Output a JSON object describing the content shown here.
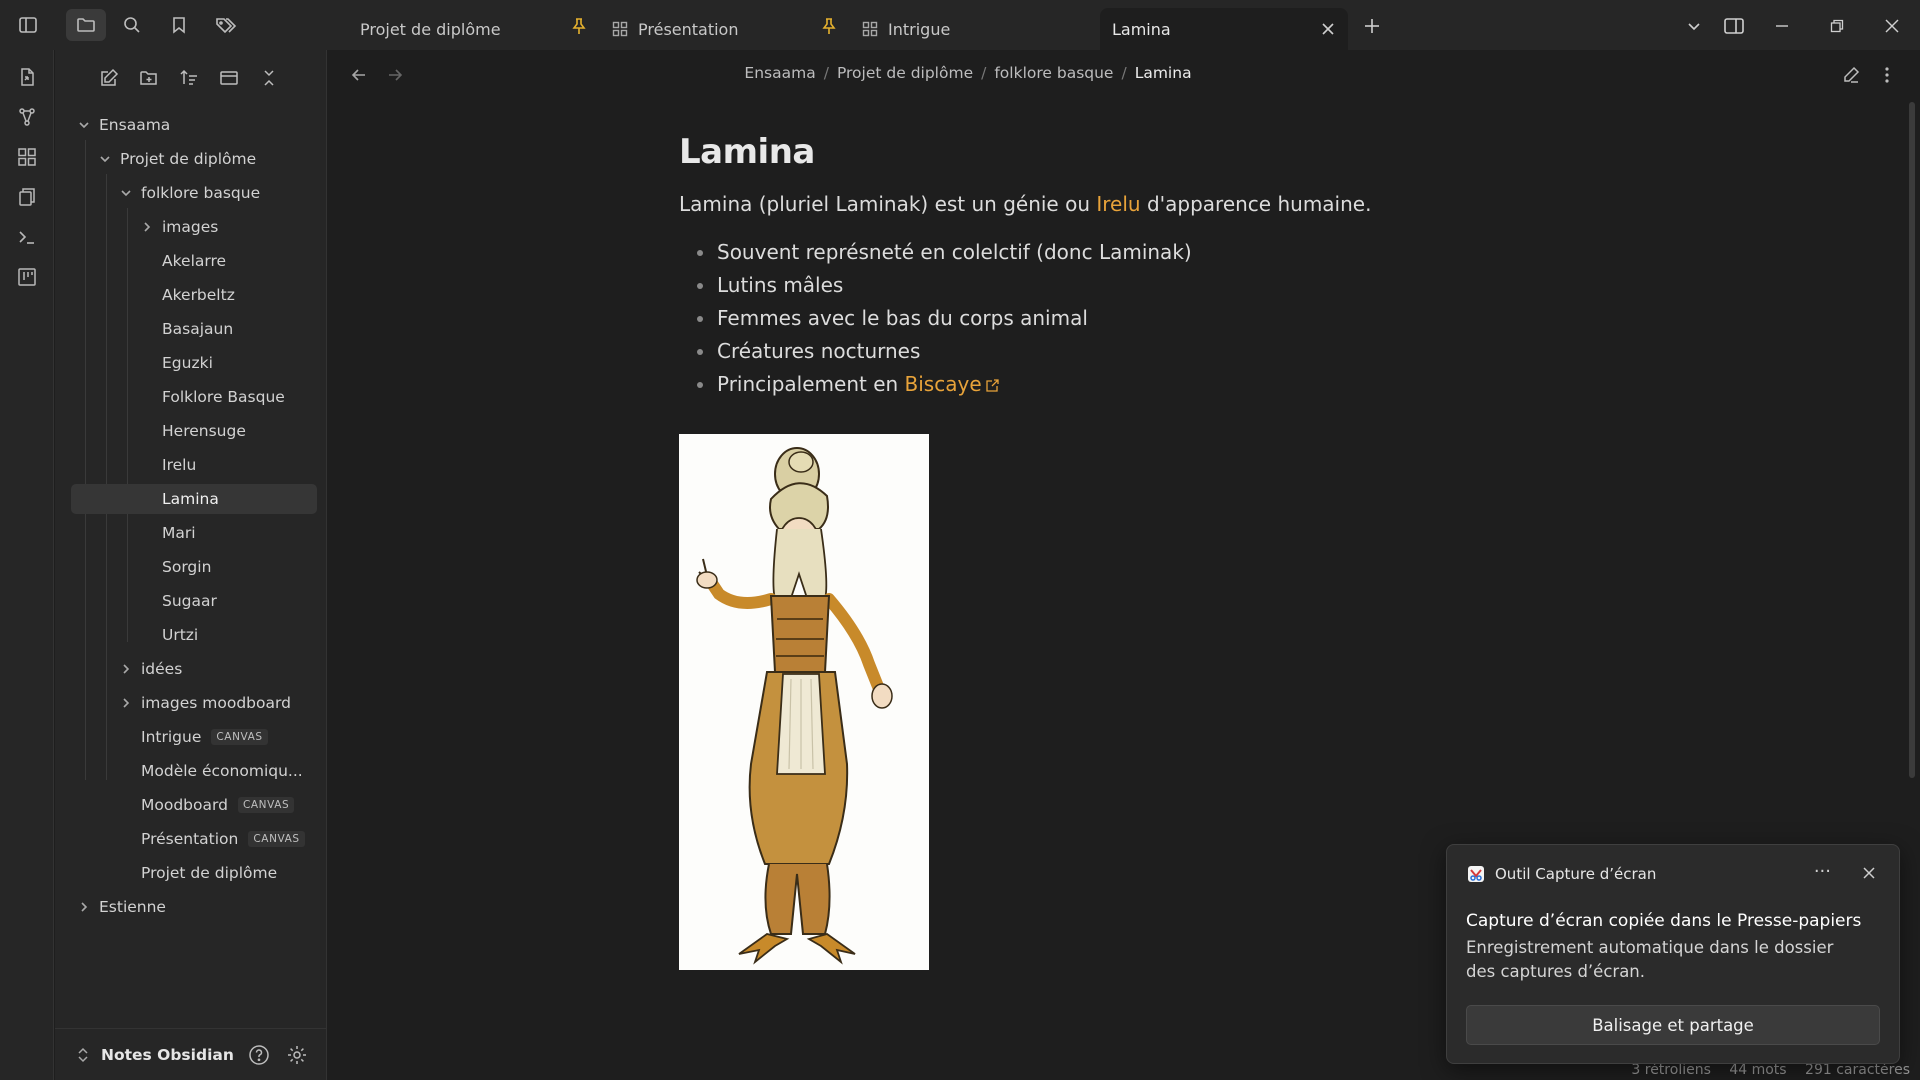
{
  "tabs": [
    {
      "label": "Projet de diplôme",
      "pinned": true
    },
    {
      "label": "Présentation",
      "pinned": true
    },
    {
      "label": "Intrigue",
      "pinned": false
    },
    {
      "label": "Lamina",
      "pinned": false,
      "active": true
    }
  ],
  "tree": {
    "root": "Ensaama",
    "project": "Projet de diplôme",
    "folder": "folklore basque",
    "images_folder": "images",
    "folder_items": [
      "Akelarre",
      "Akerbeltz",
      "Basajaun",
      "Eguzki",
      "Folklore Basque",
      "Herensuge",
      "Irelu",
      "Lamina",
      "Mari",
      "Sorgin",
      "Sugaar",
      "Urtzi"
    ],
    "selected": "Lamina",
    "project_items": [
      {
        "label": "idées",
        "folder": true
      },
      {
        "label": "images moodboard",
        "folder": true
      },
      {
        "label": "Intrigue",
        "badge": "CANVAS"
      },
      {
        "label": "Modèle économiqu..."
      },
      {
        "label": "Moodboard",
        "badge": "CANVAS"
      },
      {
        "label": "Présentation",
        "badge": "CANVAS"
      },
      {
        "label": "Projet de diplôme"
      }
    ],
    "second_root": "Estienne"
  },
  "vault": {
    "name": "Notes Obsidian"
  },
  "breadcrumb": [
    "Ensaama",
    "Projet de diplôme",
    "folklore basque",
    "Lamina"
  ],
  "note": {
    "title": "Lamina",
    "intro_before": "Lamina (pluriel Laminak) est un génie ou ",
    "intro_link": "Irelu",
    "intro_after": " d'apparence humaine.",
    "bullets": [
      "Souvent représneté en colelctif (donc Laminak)",
      "Lutins mâles",
      "Femmes avec le bas du corps animal",
      "Créatures nocturnes"
    ],
    "last_bullet_before": "Principalement en ",
    "last_bullet_link": "Biscaye"
  },
  "status": {
    "backlinks": "3 rétroliens",
    "words": "44 mots",
    "chars": "291 caractères"
  },
  "toast": {
    "app": "Outil Capture d’écran",
    "more": "···",
    "title": "Capture d’écran copiée dans le Presse-papiers",
    "body": "Enregistrement automatique dans le dossier des captures d’écran.",
    "button": "Balisage et partage"
  },
  "colors": {
    "accent": "#e8a33a",
    "pin": "#e5b12e",
    "background": "#1e1e1e",
    "sidebar": "#262626"
  }
}
